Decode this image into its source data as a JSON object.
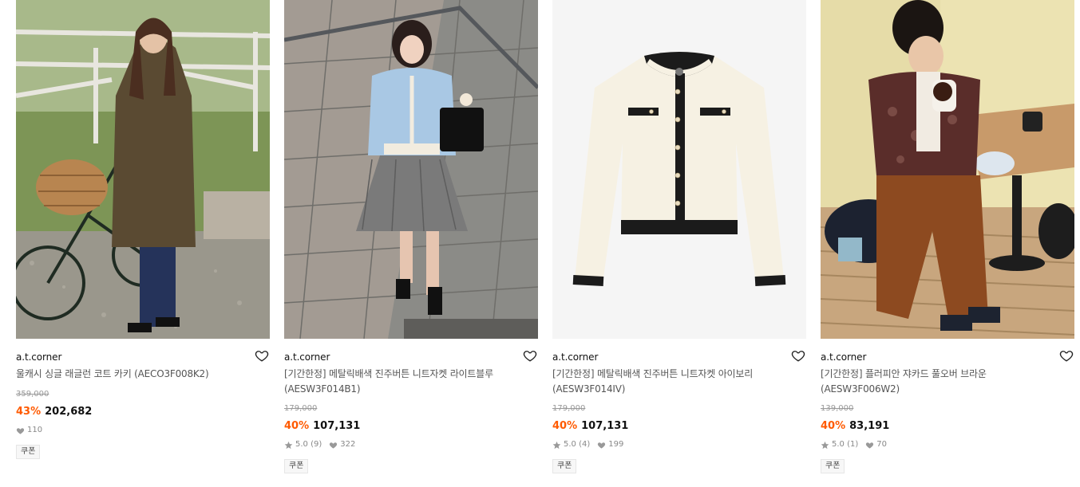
{
  "products": [
    {
      "brand": "a.t.corner",
      "name": "울캐시 싱글 래글런 코트 카키 (AECO3F008K2)",
      "original_price": "359,000",
      "discount": "43%",
      "price": "202,682",
      "rating": "",
      "review_count": "",
      "likes": "110",
      "badge": "쿠폰",
      "image": "woman-in-khaki-coat-with-bicycle",
      "like_icon": "heart-outline-icon"
    },
    {
      "brand": "a.t.corner",
      "name": "[기간한정] 메탈릭배색 진주버튼 니트자켓 라이트블루 (AESW3F014B1)",
      "original_price": "179,000",
      "discount": "40%",
      "price": "107,131",
      "rating": "5.0",
      "review_count": "(9)",
      "likes": "322",
      "badge": "쿠폰",
      "image": "woman-in-light-blue-knit-jacket-on-stairs",
      "like_icon": "heart-outline-icon"
    },
    {
      "brand": "a.t.corner",
      "name": "[기간한정] 메탈릭배색 진주버튼 니트자켓 아이보리 (AESW3F014IV)",
      "original_price": "179,000",
      "discount": "40%",
      "price": "107,131",
      "rating": "5.0",
      "review_count": "(4)",
      "likes": "199",
      "badge": "쿠폰",
      "image": "ivory-knit-cardigan-product-shot",
      "like_icon": "heart-outline-icon"
    },
    {
      "brand": "a.t.corner",
      "name": "[기간한정] 플러피안 쟈카드 풀오버 브라운 (AESW3F006W2)",
      "original_price": "139,000",
      "discount": "40%",
      "price": "83,191",
      "rating": "5.0",
      "review_count": "(1)",
      "likes": "70",
      "badge": "쿠폰",
      "image": "woman-in-brown-pullover-drinking-coffee",
      "like_icon": "heart-outline-icon"
    }
  ],
  "colors": {
    "discount": "#ff5a00",
    "price": "#111111",
    "original_price": "#999999",
    "meta": "#888888"
  }
}
